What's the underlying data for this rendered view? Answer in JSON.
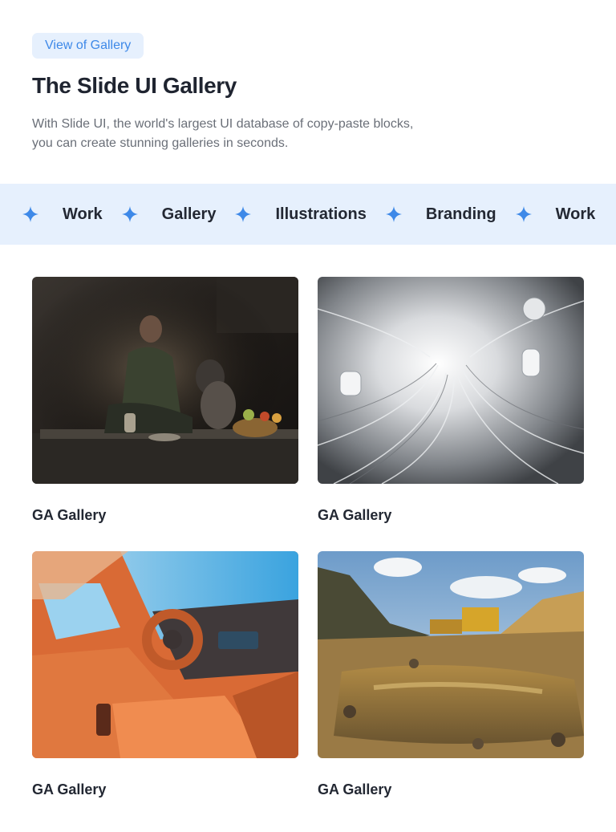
{
  "header": {
    "badge": "View of Gallery",
    "title": "The Slide UI Gallery",
    "description_line1": "With Slide UI, the world's largest UI database of copy-paste blocks,",
    "description_line2": "you can create stunning galleries in seconds."
  },
  "ticker": {
    "items": [
      "Work",
      "Gallery",
      "Illustrations",
      "Branding",
      "Work"
    ],
    "star_icon": "sparkle-icon",
    "star_color": "#3e89e8"
  },
  "gallery": {
    "cards": [
      {
        "label": "GA Gallery",
        "image": "man-with-dog-photo"
      },
      {
        "label": "GA Gallery",
        "image": "silver-cable-tunnel-render"
      },
      {
        "label": "GA Gallery",
        "image": "orange-car-interior-render"
      },
      {
        "label": "GA Gallery",
        "image": "quarry-landscape-painting"
      }
    ]
  },
  "colors": {
    "accent": "#3e89e8",
    "accent_bg": "#e6f0fd",
    "heading": "#1f2430",
    "body_text": "#6a6f78"
  }
}
